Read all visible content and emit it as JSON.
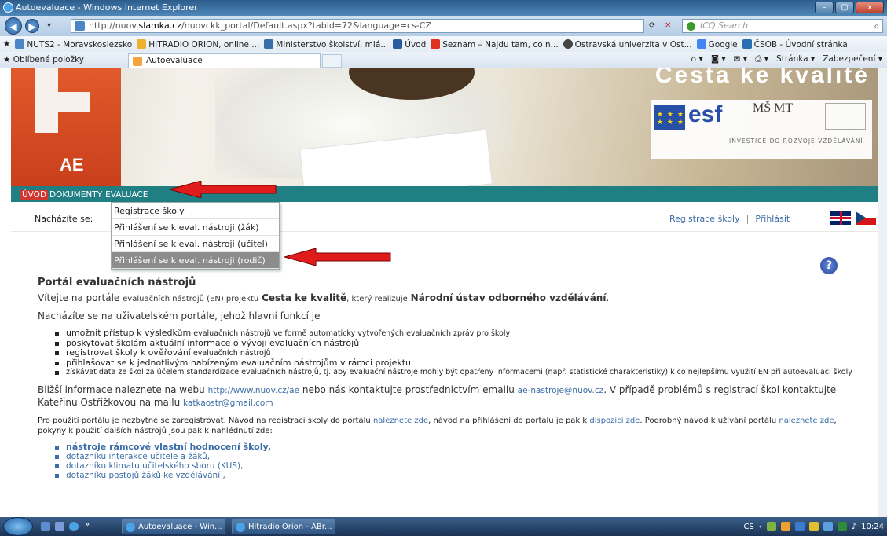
{
  "window": {
    "title": "Autoevaluace - Windows Internet Explorer",
    "controls": [
      "–",
      "▢",
      "x"
    ]
  },
  "address": {
    "url_prefix": "http://nuov.",
    "url_domain": "slamka.cz",
    "url_suffix": "/nuovckk_portal/Default.aspx?tabid=72&language=cs-CZ",
    "search_placeholder": "ICQ Search"
  },
  "favorites_bar": [
    "NUTS2 - Moravskoslezsko",
    "HITRADIO ORION, online ...",
    "Ministerstvo školství, mlá...",
    "Úvod",
    "Seznam – Najdu tam, co n...",
    "Ostravská univerzita v Ost...",
    "Google",
    "ČSOB - Úvodní stránka"
  ],
  "tabs": {
    "favorites_label": "Oblíbené položky",
    "active_tab": "Autoevaluace",
    "commands": [
      "Stránka ▾",
      "Zabezpečení ▾"
    ]
  },
  "banner": {
    "logo_text": "AE",
    "slogan": "Cesta ke kvalitě",
    "esf": "esf",
    "msmt": "MŠ MT",
    "investice": "INVESTICE DO ROZVOJE VZDĚLÁVÁNÍ"
  },
  "menu": [
    {
      "label": "Úvod",
      "active": true
    },
    {
      "label": "Dokumenty",
      "active": false
    },
    {
      "label": "Evaluace",
      "active": false
    }
  ],
  "location": {
    "label": "Nacházíte se:",
    "register_link": "Registrace školy",
    "separator": "|",
    "login_link": "Přihlásit"
  },
  "dropdown": [
    {
      "label": "Registrace školy",
      "selected": false
    },
    {
      "label": "Přihlášení se k eval. nástroji (žák)",
      "selected": false
    },
    {
      "label": "Přihlášení se k eval. nástroji (učitel)",
      "selected": false
    },
    {
      "label": "Přihlášení se k eval. nástroji (rodič)",
      "selected": true
    }
  ],
  "content": {
    "heading": "Portál evaluačních nástrojů",
    "welcome": {
      "a": "Vítejte na portále",
      "b": "evaluačních nástrojů (EN) projektu",
      "c": "Cesta ke kvalitě",
      "d": ", který realizuje",
      "e": "Národní ústav odborného vzdělávání",
      "f": "."
    },
    "intro": "Nacházíte se na uživatelském portále, jehož hlavní funkcí je",
    "bullets": [
      {
        "a": "umožnit přístup k výsledkům",
        "b": " evaluačních nástrojů ve formě automaticky vytvořených evaluačních zpráv pro školy"
      },
      {
        "a": "poskytovat školám aktuální informace o vývoji evaluačních nástrojů",
        "b": ""
      },
      {
        "a": "registrovat školy k ověřování",
        "b": " evaluačních nástrojů"
      },
      {
        "a": "přihlašovat se k jednotlivým nabízeným evaluačním nástrojům v rámci projektu",
        "b": ""
      }
    ],
    "bullet_small": "získávat data ze škol za účelem standardizace evaluačních nástrojů, tj. aby evaluační nástroje mohly být opatřeny informacemi (např. statistické charakteristiky) k co nejlepšímu využití EN při autoevaluaci školy",
    "info": {
      "a": "Bližší informace naleznete na webu",
      "url": "http://www.nuov.cz/ae",
      "b": "nebo nás kontaktujte prostřednictvím emailu",
      "email": "ae-nastroje@nuov.cz",
      "c": ". V případě problémů s registrací škol kontaktujte Kateřinu Ostřížkovou na mailu",
      "email2": "katkaostr@gmail.com"
    },
    "registration": {
      "a": "Pro použití portálu je nezbytné se zaregistrovat. Návod na registraci školy do portálu",
      "l1": "naleznete zde",
      "b": ", návod na přihlášení do portálu je pak k",
      "l2": "dispozici zde",
      "c": ". Podrobný návod k užívání portálu",
      "l3": "naleznete zde",
      "d": ", pokyny k použití dalších nástrojů jsou pak k nahlédnutí zde:"
    },
    "links": [
      "nástroje rámcové vlastní hodnocení školy,",
      "dotazníku interakce učitele a žáků,",
      "dotazníku klimatu učitelského sboru (KUS),",
      "dotazníku postojů žáků ke vzdělávání ,"
    ]
  },
  "taskbar": {
    "buttons": [
      "Autoevaluace - Win...",
      "Hitradio Orion - ABr..."
    ],
    "lang": "CS",
    "time": "10:24"
  },
  "colors": {
    "menu_bg": "#1f7f83",
    "menu_active": "#d2362e",
    "link": "#3b6da6",
    "arrow": "#e01b1b"
  }
}
